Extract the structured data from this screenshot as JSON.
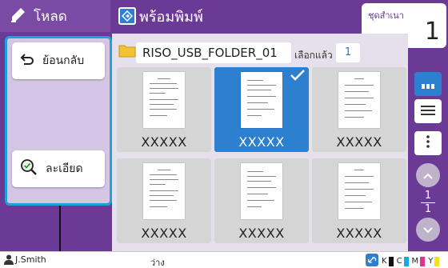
{
  "header": {
    "mode_label": "โหลด",
    "screen_title": "พร้อมพิมพ์",
    "copies_caption": "ชุดสำเนา",
    "copies_value": "1"
  },
  "sidebar": {
    "back_label": "ย้อนกลับ",
    "detail_label": "ละเอียด"
  },
  "folder": {
    "name": "RISO_USB_FOLDER_01",
    "selected_label": "เลือกแล้ว",
    "selected_count": "1"
  },
  "thumbnails": [
    {
      "name": "XXXXX",
      "selected": false
    },
    {
      "name": "XXXXX",
      "selected": true
    },
    {
      "name": "XXXXX",
      "selected": false
    },
    {
      "name": "XXXXX",
      "selected": false
    },
    {
      "name": "XXXXX",
      "selected": false
    },
    {
      "name": "XXXXX",
      "selected": false
    }
  ],
  "pager": {
    "current": "1",
    "total": "1"
  },
  "status": {
    "user": "J.Smith",
    "state": "ว่าง",
    "ink_labels": [
      "K",
      "C",
      "M",
      "Y"
    ]
  },
  "colors": {
    "frame": "#6b3a97",
    "accent": "#2d7fd0",
    "callout_border": "#1ca3dc",
    "ink_k": "#111111",
    "ink_c": "#1aa7e0",
    "ink_m": "#e0358f",
    "ink_y": "#f2e21c"
  }
}
